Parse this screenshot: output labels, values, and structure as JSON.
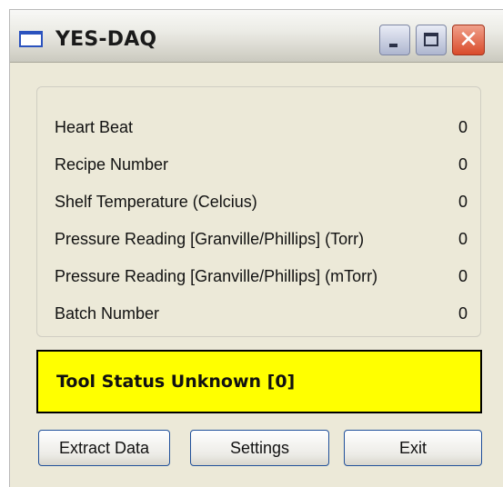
{
  "window": {
    "title": "YES-DAQ",
    "icon": "window-app-icon",
    "controls": [
      "minimize-icon",
      "maximize-icon",
      "close-icon"
    ]
  },
  "readings": [
    {
      "label": "Heart Beat",
      "value": "0"
    },
    {
      "label": "Recipe Number",
      "value": "0"
    },
    {
      "label": "Shelf Temperature (Celcius)",
      "value": "0"
    },
    {
      "label": "Pressure Reading [Granville/Phillips] (Torr)",
      "value": "0"
    },
    {
      "label": "Pressure Reading [Granville/Phillips] (mTorr)",
      "value": "0"
    },
    {
      "label": "Batch Number",
      "value": "0"
    }
  ],
  "status": {
    "text": "Tool Status Unknown [0]",
    "color": "#ffff00"
  },
  "buttons": {
    "extract": "Extract Data",
    "settings": "Settings",
    "exit": "Exit"
  }
}
